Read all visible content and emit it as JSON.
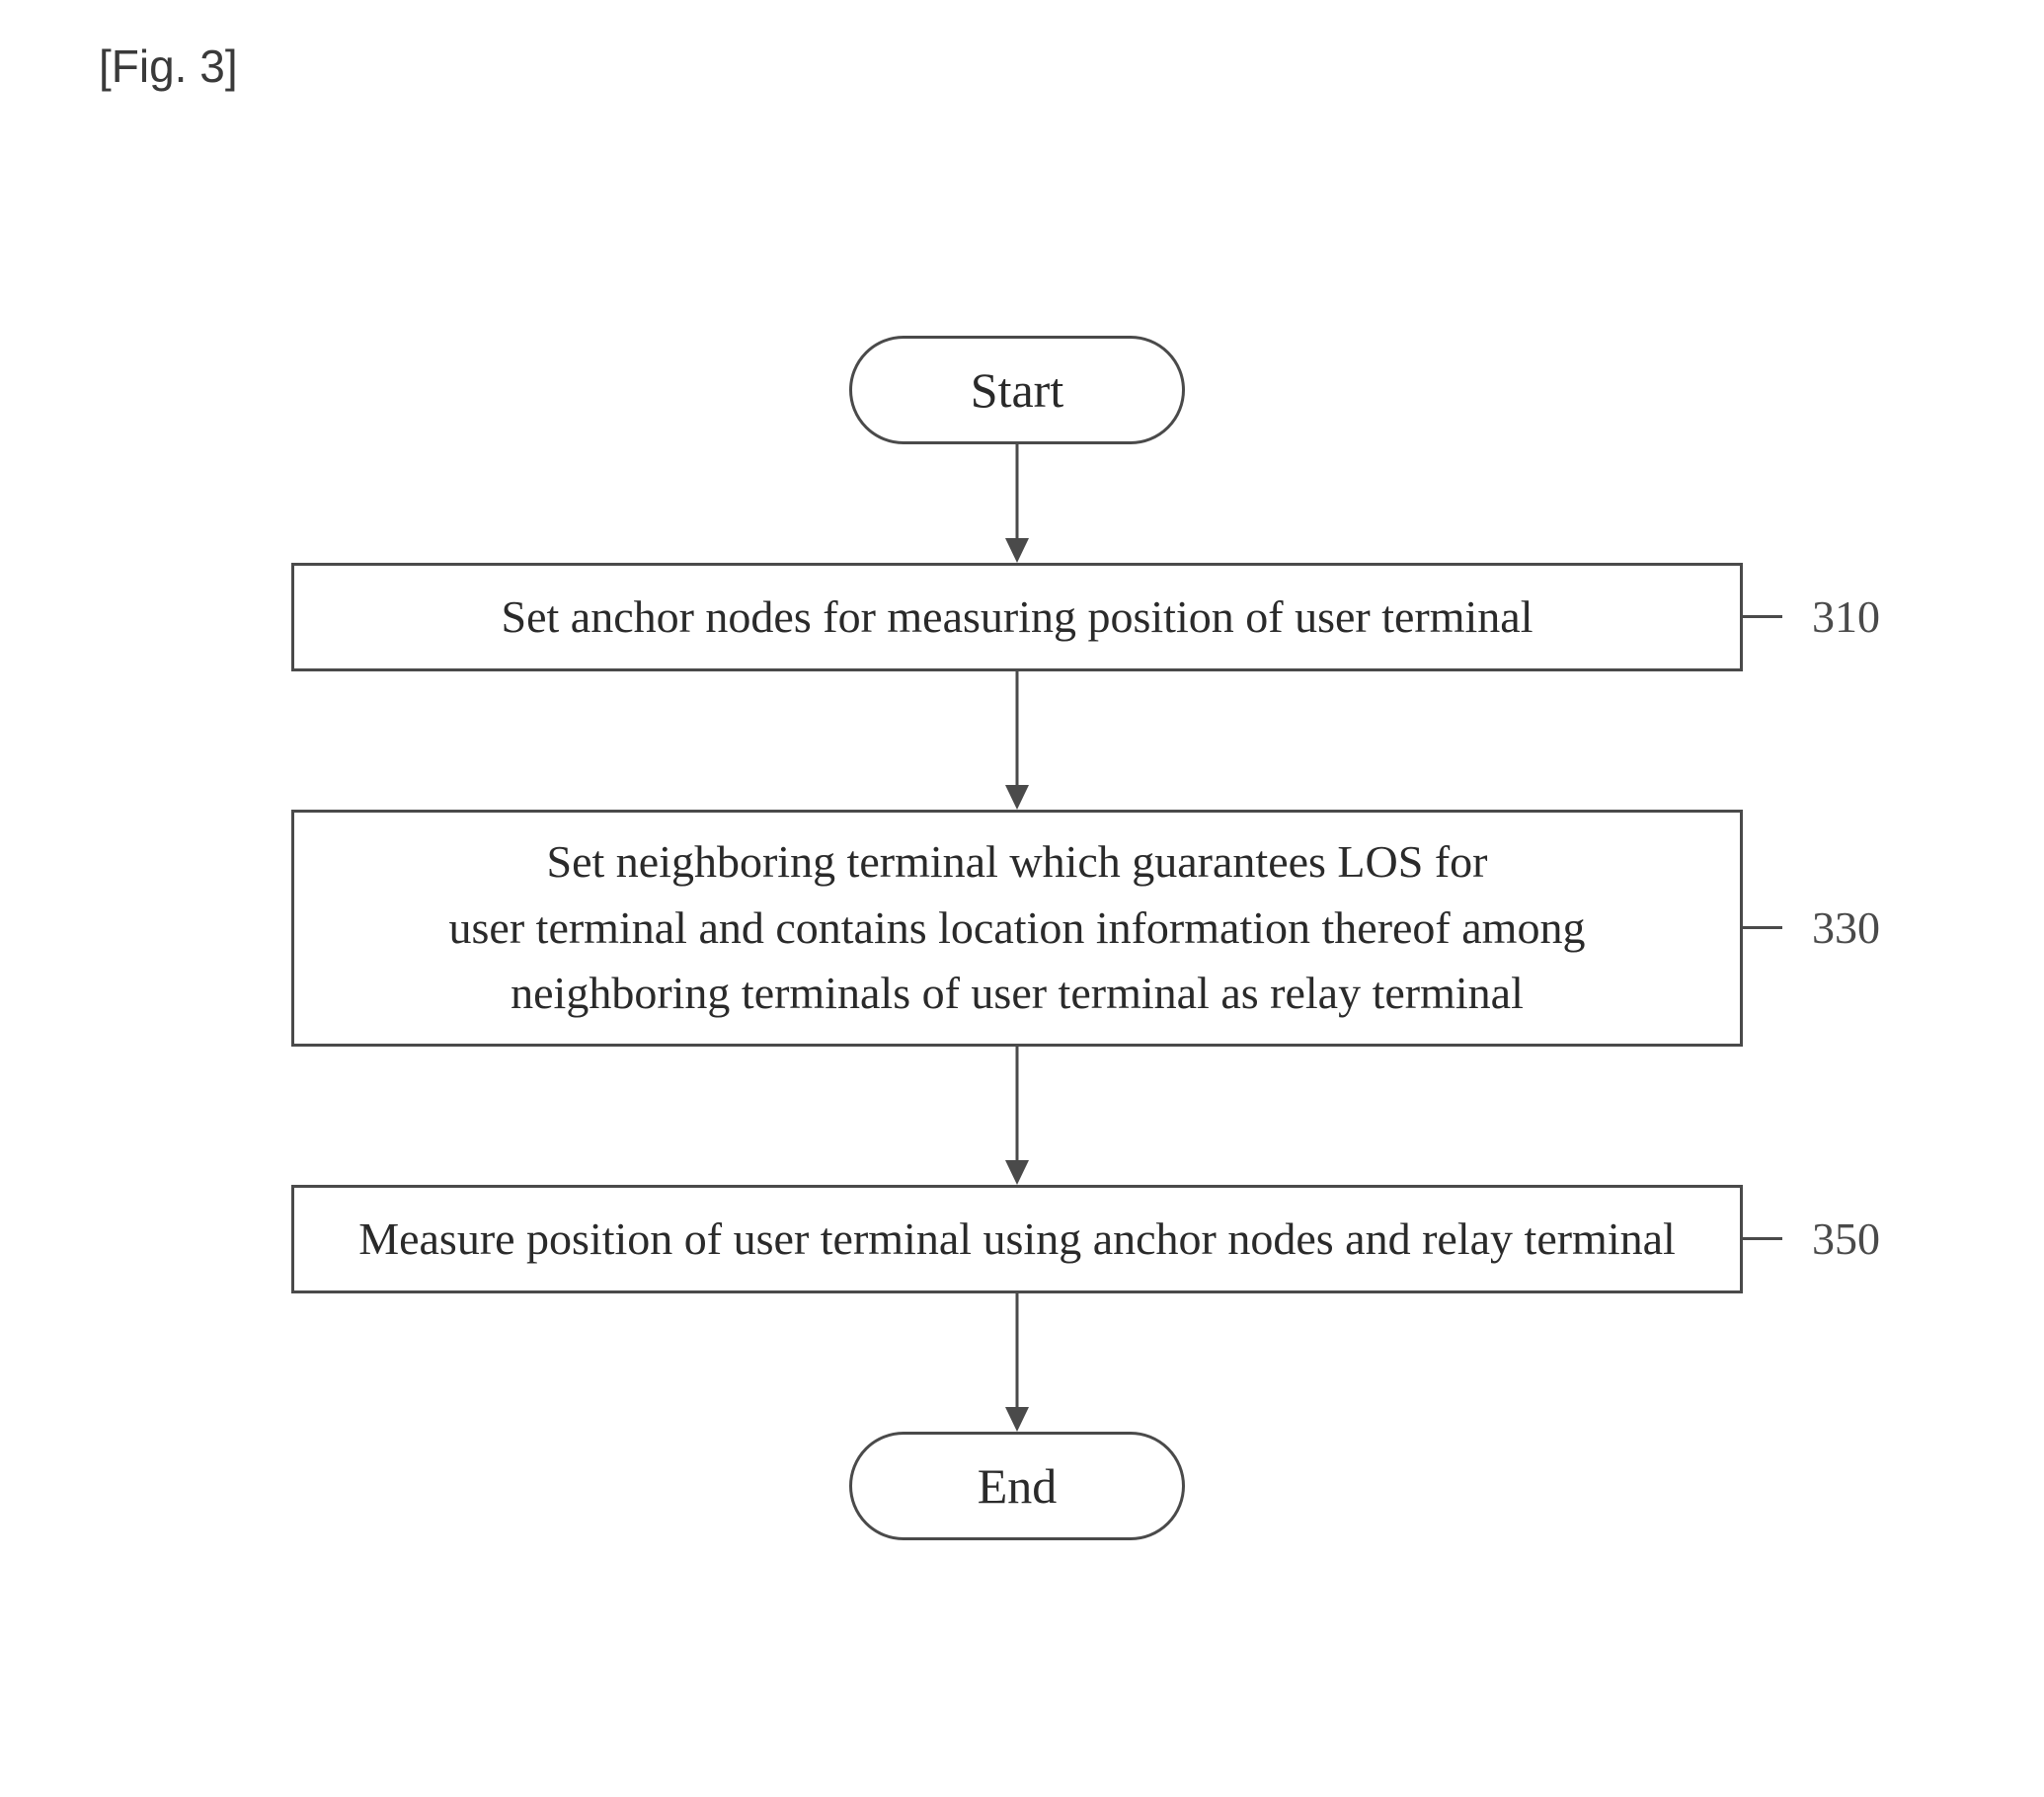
{
  "figure_label": "[Fig. 3]",
  "start_label": "Start",
  "end_label": "End",
  "steps": {
    "s310": {
      "text": "Set anchor nodes for measuring position of user terminal",
      "num": "310"
    },
    "s330": {
      "text": "Set neighboring terminal which guarantees LOS for\nuser terminal and contains location information thereof among\nneighboring terminals of user terminal as relay terminal",
      "num": "330"
    },
    "s350": {
      "text": "Measure position of user terminal using anchor nodes and relay terminal",
      "num": "350"
    }
  }
}
